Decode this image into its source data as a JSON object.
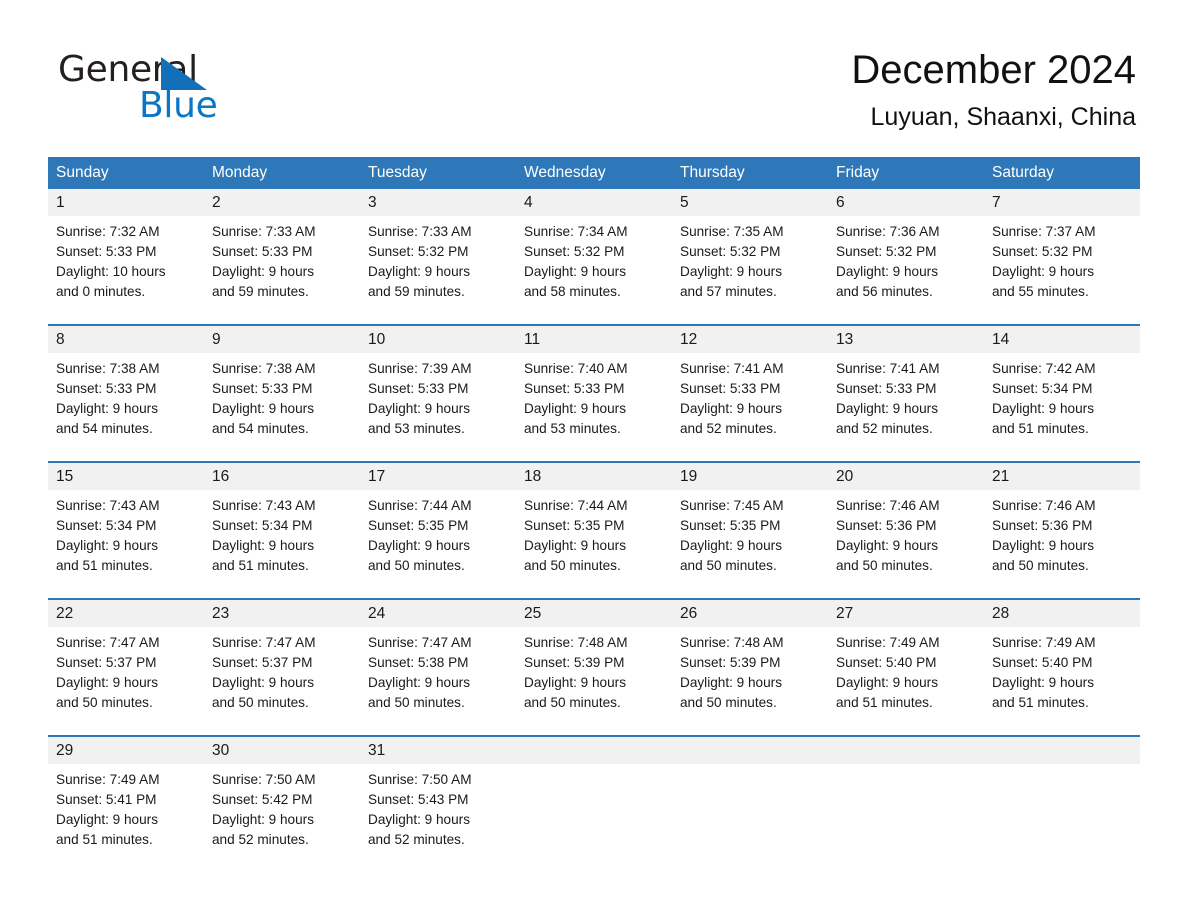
{
  "brand": {
    "word_one": "General",
    "word_two": "Blue",
    "triangle_color": "#136fb7",
    "blue_text_color": "#0b76c4"
  },
  "header": {
    "month_title": "December 2024",
    "location": "Luyuan, Shaanxi, China"
  },
  "calendar": {
    "header_bg": "#2e78b9",
    "date_band_bg": "#f1f1f1",
    "weekdays": [
      "Sunday",
      "Monday",
      "Tuesday",
      "Wednesday",
      "Thursday",
      "Friday",
      "Saturday"
    ],
    "weeks": [
      [
        {
          "date": "1",
          "lines": [
            "Sunrise: 7:32 AM",
            "Sunset: 5:33 PM",
            "Daylight: 10 hours",
            "and 0 minutes."
          ]
        },
        {
          "date": "2",
          "lines": [
            "Sunrise: 7:33 AM",
            "Sunset: 5:33 PM",
            "Daylight: 9 hours",
            "and 59 minutes."
          ]
        },
        {
          "date": "3",
          "lines": [
            "Sunrise: 7:33 AM",
            "Sunset: 5:32 PM",
            "Daylight: 9 hours",
            "and 59 minutes."
          ]
        },
        {
          "date": "4",
          "lines": [
            "Sunrise: 7:34 AM",
            "Sunset: 5:32 PM",
            "Daylight: 9 hours",
            "and 58 minutes."
          ]
        },
        {
          "date": "5",
          "lines": [
            "Sunrise: 7:35 AM",
            "Sunset: 5:32 PM",
            "Daylight: 9 hours",
            "and 57 minutes."
          ]
        },
        {
          "date": "6",
          "lines": [
            "Sunrise: 7:36 AM",
            "Sunset: 5:32 PM",
            "Daylight: 9 hours",
            "and 56 minutes."
          ]
        },
        {
          "date": "7",
          "lines": [
            "Sunrise: 7:37 AM",
            "Sunset: 5:32 PM",
            "Daylight: 9 hours",
            "and 55 minutes."
          ]
        }
      ],
      [
        {
          "date": "8",
          "lines": [
            "Sunrise: 7:38 AM",
            "Sunset: 5:33 PM",
            "Daylight: 9 hours",
            "and 54 minutes."
          ]
        },
        {
          "date": "9",
          "lines": [
            "Sunrise: 7:38 AM",
            "Sunset: 5:33 PM",
            "Daylight: 9 hours",
            "and 54 minutes."
          ]
        },
        {
          "date": "10",
          "lines": [
            "Sunrise: 7:39 AM",
            "Sunset: 5:33 PM",
            "Daylight: 9 hours",
            "and 53 minutes."
          ]
        },
        {
          "date": "11",
          "lines": [
            "Sunrise: 7:40 AM",
            "Sunset: 5:33 PM",
            "Daylight: 9 hours",
            "and 53 minutes."
          ]
        },
        {
          "date": "12",
          "lines": [
            "Sunrise: 7:41 AM",
            "Sunset: 5:33 PM",
            "Daylight: 9 hours",
            "and 52 minutes."
          ]
        },
        {
          "date": "13",
          "lines": [
            "Sunrise: 7:41 AM",
            "Sunset: 5:33 PM",
            "Daylight: 9 hours",
            "and 52 minutes."
          ]
        },
        {
          "date": "14",
          "lines": [
            "Sunrise: 7:42 AM",
            "Sunset: 5:34 PM",
            "Daylight: 9 hours",
            "and 51 minutes."
          ]
        }
      ],
      [
        {
          "date": "15",
          "lines": [
            "Sunrise: 7:43 AM",
            "Sunset: 5:34 PM",
            "Daylight: 9 hours",
            "and 51 minutes."
          ]
        },
        {
          "date": "16",
          "lines": [
            "Sunrise: 7:43 AM",
            "Sunset: 5:34 PM",
            "Daylight: 9 hours",
            "and 51 minutes."
          ]
        },
        {
          "date": "17",
          "lines": [
            "Sunrise: 7:44 AM",
            "Sunset: 5:35 PM",
            "Daylight: 9 hours",
            "and 50 minutes."
          ]
        },
        {
          "date": "18",
          "lines": [
            "Sunrise: 7:44 AM",
            "Sunset: 5:35 PM",
            "Daylight: 9 hours",
            "and 50 minutes."
          ]
        },
        {
          "date": "19",
          "lines": [
            "Sunrise: 7:45 AM",
            "Sunset: 5:35 PM",
            "Daylight: 9 hours",
            "and 50 minutes."
          ]
        },
        {
          "date": "20",
          "lines": [
            "Sunrise: 7:46 AM",
            "Sunset: 5:36 PM",
            "Daylight: 9 hours",
            "and 50 minutes."
          ]
        },
        {
          "date": "21",
          "lines": [
            "Sunrise: 7:46 AM",
            "Sunset: 5:36 PM",
            "Daylight: 9 hours",
            "and 50 minutes."
          ]
        }
      ],
      [
        {
          "date": "22",
          "lines": [
            "Sunrise: 7:47 AM",
            "Sunset: 5:37 PM",
            "Daylight: 9 hours",
            "and 50 minutes."
          ]
        },
        {
          "date": "23",
          "lines": [
            "Sunrise: 7:47 AM",
            "Sunset: 5:37 PM",
            "Daylight: 9 hours",
            "and 50 minutes."
          ]
        },
        {
          "date": "24",
          "lines": [
            "Sunrise: 7:47 AM",
            "Sunset: 5:38 PM",
            "Daylight: 9 hours",
            "and 50 minutes."
          ]
        },
        {
          "date": "25",
          "lines": [
            "Sunrise: 7:48 AM",
            "Sunset: 5:39 PM",
            "Daylight: 9 hours",
            "and 50 minutes."
          ]
        },
        {
          "date": "26",
          "lines": [
            "Sunrise: 7:48 AM",
            "Sunset: 5:39 PM",
            "Daylight: 9 hours",
            "and 50 minutes."
          ]
        },
        {
          "date": "27",
          "lines": [
            "Sunrise: 7:49 AM",
            "Sunset: 5:40 PM",
            "Daylight: 9 hours",
            "and 51 minutes."
          ]
        },
        {
          "date": "28",
          "lines": [
            "Sunrise: 7:49 AM",
            "Sunset: 5:40 PM",
            "Daylight: 9 hours",
            "and 51 minutes."
          ]
        }
      ],
      [
        {
          "date": "29",
          "lines": [
            "Sunrise: 7:49 AM",
            "Sunset: 5:41 PM",
            "Daylight: 9 hours",
            "and 51 minutes."
          ]
        },
        {
          "date": "30",
          "lines": [
            "Sunrise: 7:50 AM",
            "Sunset: 5:42 PM",
            "Daylight: 9 hours",
            "and 52 minutes."
          ]
        },
        {
          "date": "31",
          "lines": [
            "Sunrise: 7:50 AM",
            "Sunset: 5:43 PM",
            "Daylight: 9 hours",
            "and 52 minutes."
          ]
        },
        {
          "date": "",
          "lines": []
        },
        {
          "date": "",
          "lines": []
        },
        {
          "date": "",
          "lines": []
        },
        {
          "date": "",
          "lines": []
        }
      ]
    ]
  }
}
